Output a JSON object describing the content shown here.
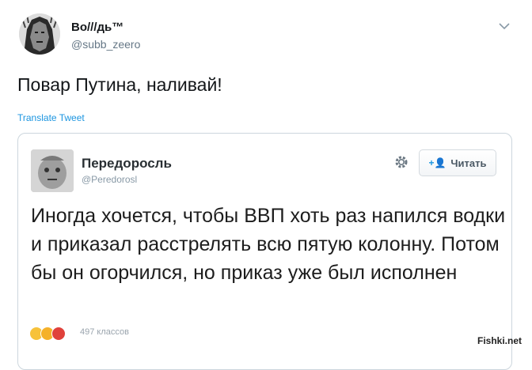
{
  "tweet": {
    "author_name": "Во///дь™",
    "author_handle": "@subb_zeero",
    "text": "Повар Путина, наливай!",
    "translate_label": "Translate Tweet",
    "menu_icon": "chevron-down-icon"
  },
  "quoted_tweet": {
    "author_name": "Передоросль",
    "author_handle": "@Peredorosl",
    "follow_label": "Читать",
    "follow_icon": "+👤",
    "text": "Иногда хочется, чтобы ВВП хоть раз напился водки и приказал расстрелять всю пятую колонну. Потом бы он огорчился, но приказ уже был исполнен",
    "likes_text": "497 классов"
  },
  "watermark": "Fishki.net",
  "colors": {
    "link": "#1b95e0",
    "secondary_text": "#657786",
    "border": "#ccd6dd"
  }
}
